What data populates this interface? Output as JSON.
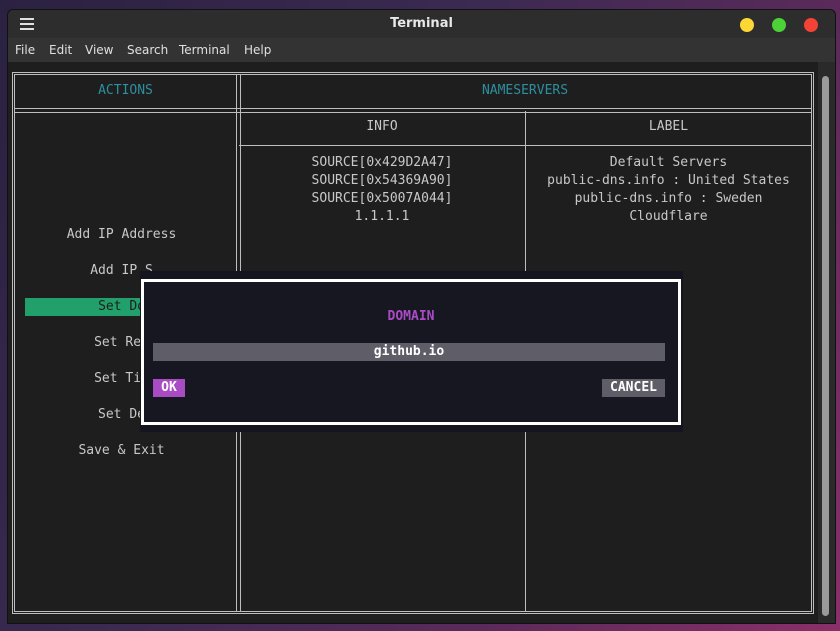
{
  "window": {
    "title": "Terminal",
    "menu": [
      "File",
      "Edit",
      "View",
      "Search",
      "Terminal",
      "Help"
    ],
    "controls": {
      "minimize_color": "#fdd835",
      "maximize_color": "#4cd137",
      "close_color": "#f44336"
    }
  },
  "actions_panel": {
    "header": "ACTIONS",
    "items": [
      "Add IP Address",
      "Add IP S",
      "Set Dom",
      "Set Rep",
      "Set Tim",
      "Set De",
      "Save & Exit"
    ],
    "selected_index": 2
  },
  "nameservers_panel": {
    "header": "NAMESERVERS",
    "columns": [
      "INFO",
      "LABEL"
    ],
    "rows": [
      {
        "info": "SOURCE[0x429D2A47]",
        "label": "Default Servers"
      },
      {
        "info": "SOURCE[0x54369A90]",
        "label": "public-dns.info : United States"
      },
      {
        "info": "SOURCE[0x5007A044]",
        "label": "public-dns.info : Sweden"
      },
      {
        "info": "1.1.1.1",
        "label": "Cloudflare"
      }
    ]
  },
  "dialog": {
    "title": "DOMAIN",
    "input_value": "github.io",
    "ok_label": "OK",
    "cancel_label": "CANCEL"
  },
  "colors": {
    "header_accent": "#2d8fa0",
    "selected_item": "#22a06b",
    "dialog_accent": "#a94cc4"
  }
}
